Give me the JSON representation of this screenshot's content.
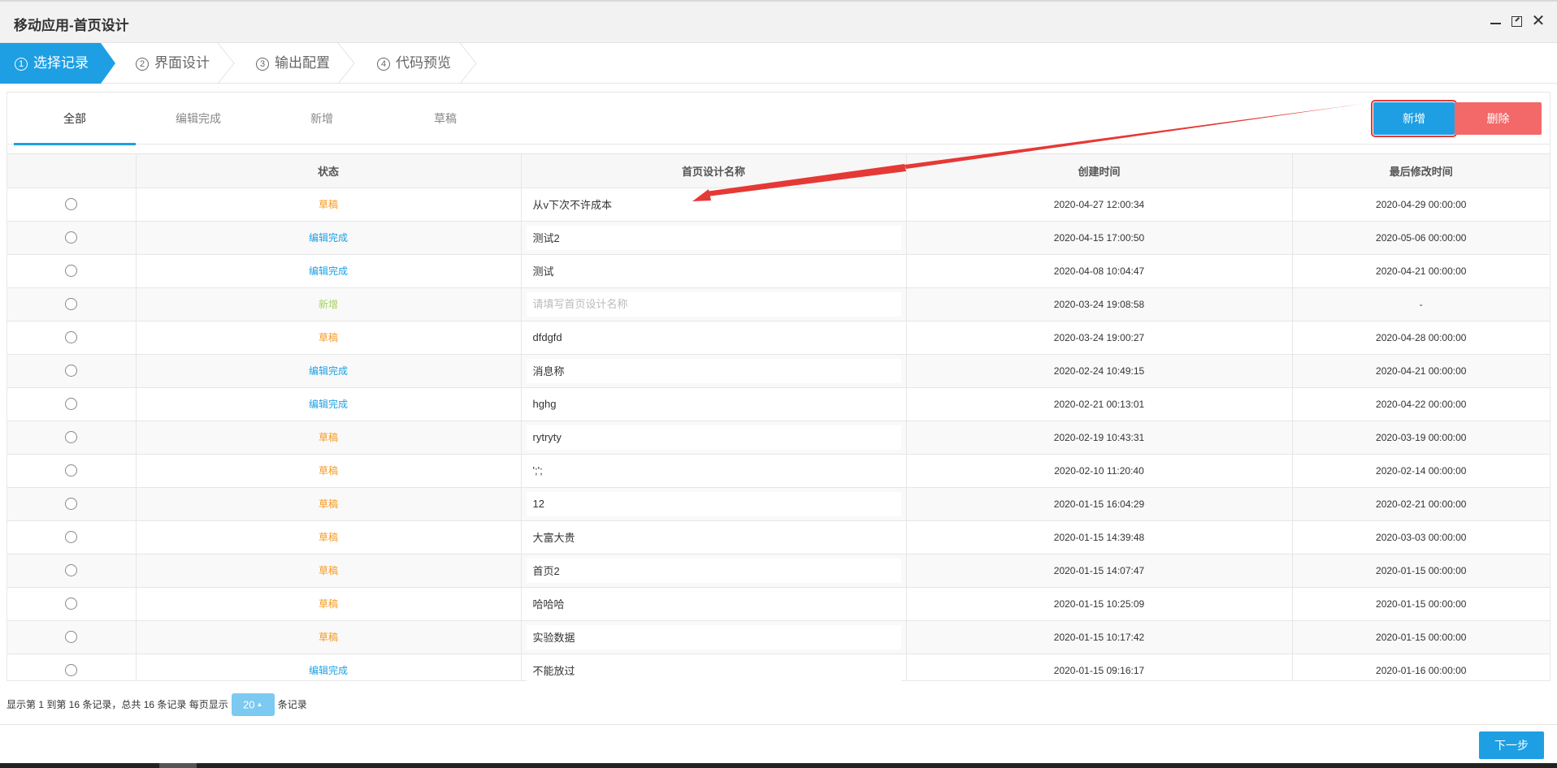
{
  "window": {
    "title": "移动应用-首页设计",
    "controls": [
      "minimize-icon",
      "maximize-icon",
      "close-icon"
    ],
    "close_glyph": "✕"
  },
  "steps": [
    {
      "num": "1",
      "label": "选择记录",
      "active": true
    },
    {
      "num": "2",
      "label": "界面设计",
      "active": false
    },
    {
      "num": "3",
      "label": "输出配置",
      "active": false
    },
    {
      "num": "4",
      "label": "代码预览",
      "active": false
    }
  ],
  "tabs": [
    {
      "label": "全部",
      "active": true
    },
    {
      "label": "编辑完成",
      "active": false
    },
    {
      "label": "新增",
      "active": false
    },
    {
      "label": "草稿",
      "active": false
    }
  ],
  "toolbar": {
    "add_label": "新增",
    "delete_label": "删除"
  },
  "table": {
    "columns": [
      "",
      "状态",
      "首页设计名称",
      "创建时间",
      "最后修改时间"
    ],
    "name_placeholder": "请填写首页设计名称",
    "rows": [
      {
        "status": "草稿",
        "status_type": "draft",
        "name": "从v下次不许成本",
        "created": "2020-04-27 12:00:34",
        "modified": "2020-04-29 00:00:00"
      },
      {
        "status": "编辑完成",
        "status_type": "done",
        "name": "测试2",
        "created": "2020-04-15 17:00:50",
        "modified": "2020-05-06 00:00:00"
      },
      {
        "status": "编辑完成",
        "status_type": "done",
        "name": "测试",
        "created": "2020-04-08 10:04:47",
        "modified": "2020-04-21 00:00:00"
      },
      {
        "status": "新增",
        "status_type": "new",
        "name": "",
        "created": "2020-03-24 19:08:58",
        "modified": "-"
      },
      {
        "status": "草稿",
        "status_type": "draft",
        "name": "dfdgfd",
        "created": "2020-03-24 19:00:27",
        "modified": "2020-04-28 00:00:00"
      },
      {
        "status": "编辑完成",
        "status_type": "done",
        "name": "消息称",
        "created": "2020-02-24 10:49:15",
        "modified": "2020-04-21 00:00:00"
      },
      {
        "status": "编辑完成",
        "status_type": "done",
        "name": "hghg",
        "created": "2020-02-21 00:13:01",
        "modified": "2020-04-22 00:00:00"
      },
      {
        "status": "草稿",
        "status_type": "draft",
        "name": "rytryty",
        "created": "2020-02-19 10:43:31",
        "modified": "2020-03-19 00:00:00"
      },
      {
        "status": "草稿",
        "status_type": "draft",
        "name": "';';",
        "created": "2020-02-10 11:20:40",
        "modified": "2020-02-14 00:00:00"
      },
      {
        "status": "草稿",
        "status_type": "draft",
        "name": "12",
        "created": "2020-01-15 16:04:29",
        "modified": "2020-02-21 00:00:00"
      },
      {
        "status": "草稿",
        "status_type": "draft",
        "name": "大富大贵",
        "created": "2020-01-15 14:39:48",
        "modified": "2020-03-03 00:00:00"
      },
      {
        "status": "草稿",
        "status_type": "draft",
        "name": "首页2",
        "created": "2020-01-15 14:07:47",
        "modified": "2020-01-15 00:00:00"
      },
      {
        "status": "草稿",
        "status_type": "draft",
        "name": "哈哈哈",
        "created": "2020-01-15 10:25:09",
        "modified": "2020-01-15 00:00:00"
      },
      {
        "status": "草稿",
        "status_type": "draft",
        "name": "实验数据",
        "created": "2020-01-15 10:17:42",
        "modified": "2020-01-15 00:00:00"
      },
      {
        "status": "编辑完成",
        "status_type": "done",
        "name": "不能放过",
        "created": "2020-01-15 09:16:17",
        "modified": "2020-01-16 00:00:00"
      }
    ]
  },
  "pagination": {
    "summary": "显示第 1 到第 16 条记录，总共 16 条记录 每页显示",
    "page_size": "20",
    "suffix": "条记录"
  },
  "footer": {
    "next_label": "下一步"
  },
  "colors": {
    "accent": "#1e9fe4",
    "danger": "#f36868",
    "draft": "#f59a23",
    "done": "#1e9fe4",
    "new": "#a6d15b",
    "annotation": "#e53935"
  }
}
